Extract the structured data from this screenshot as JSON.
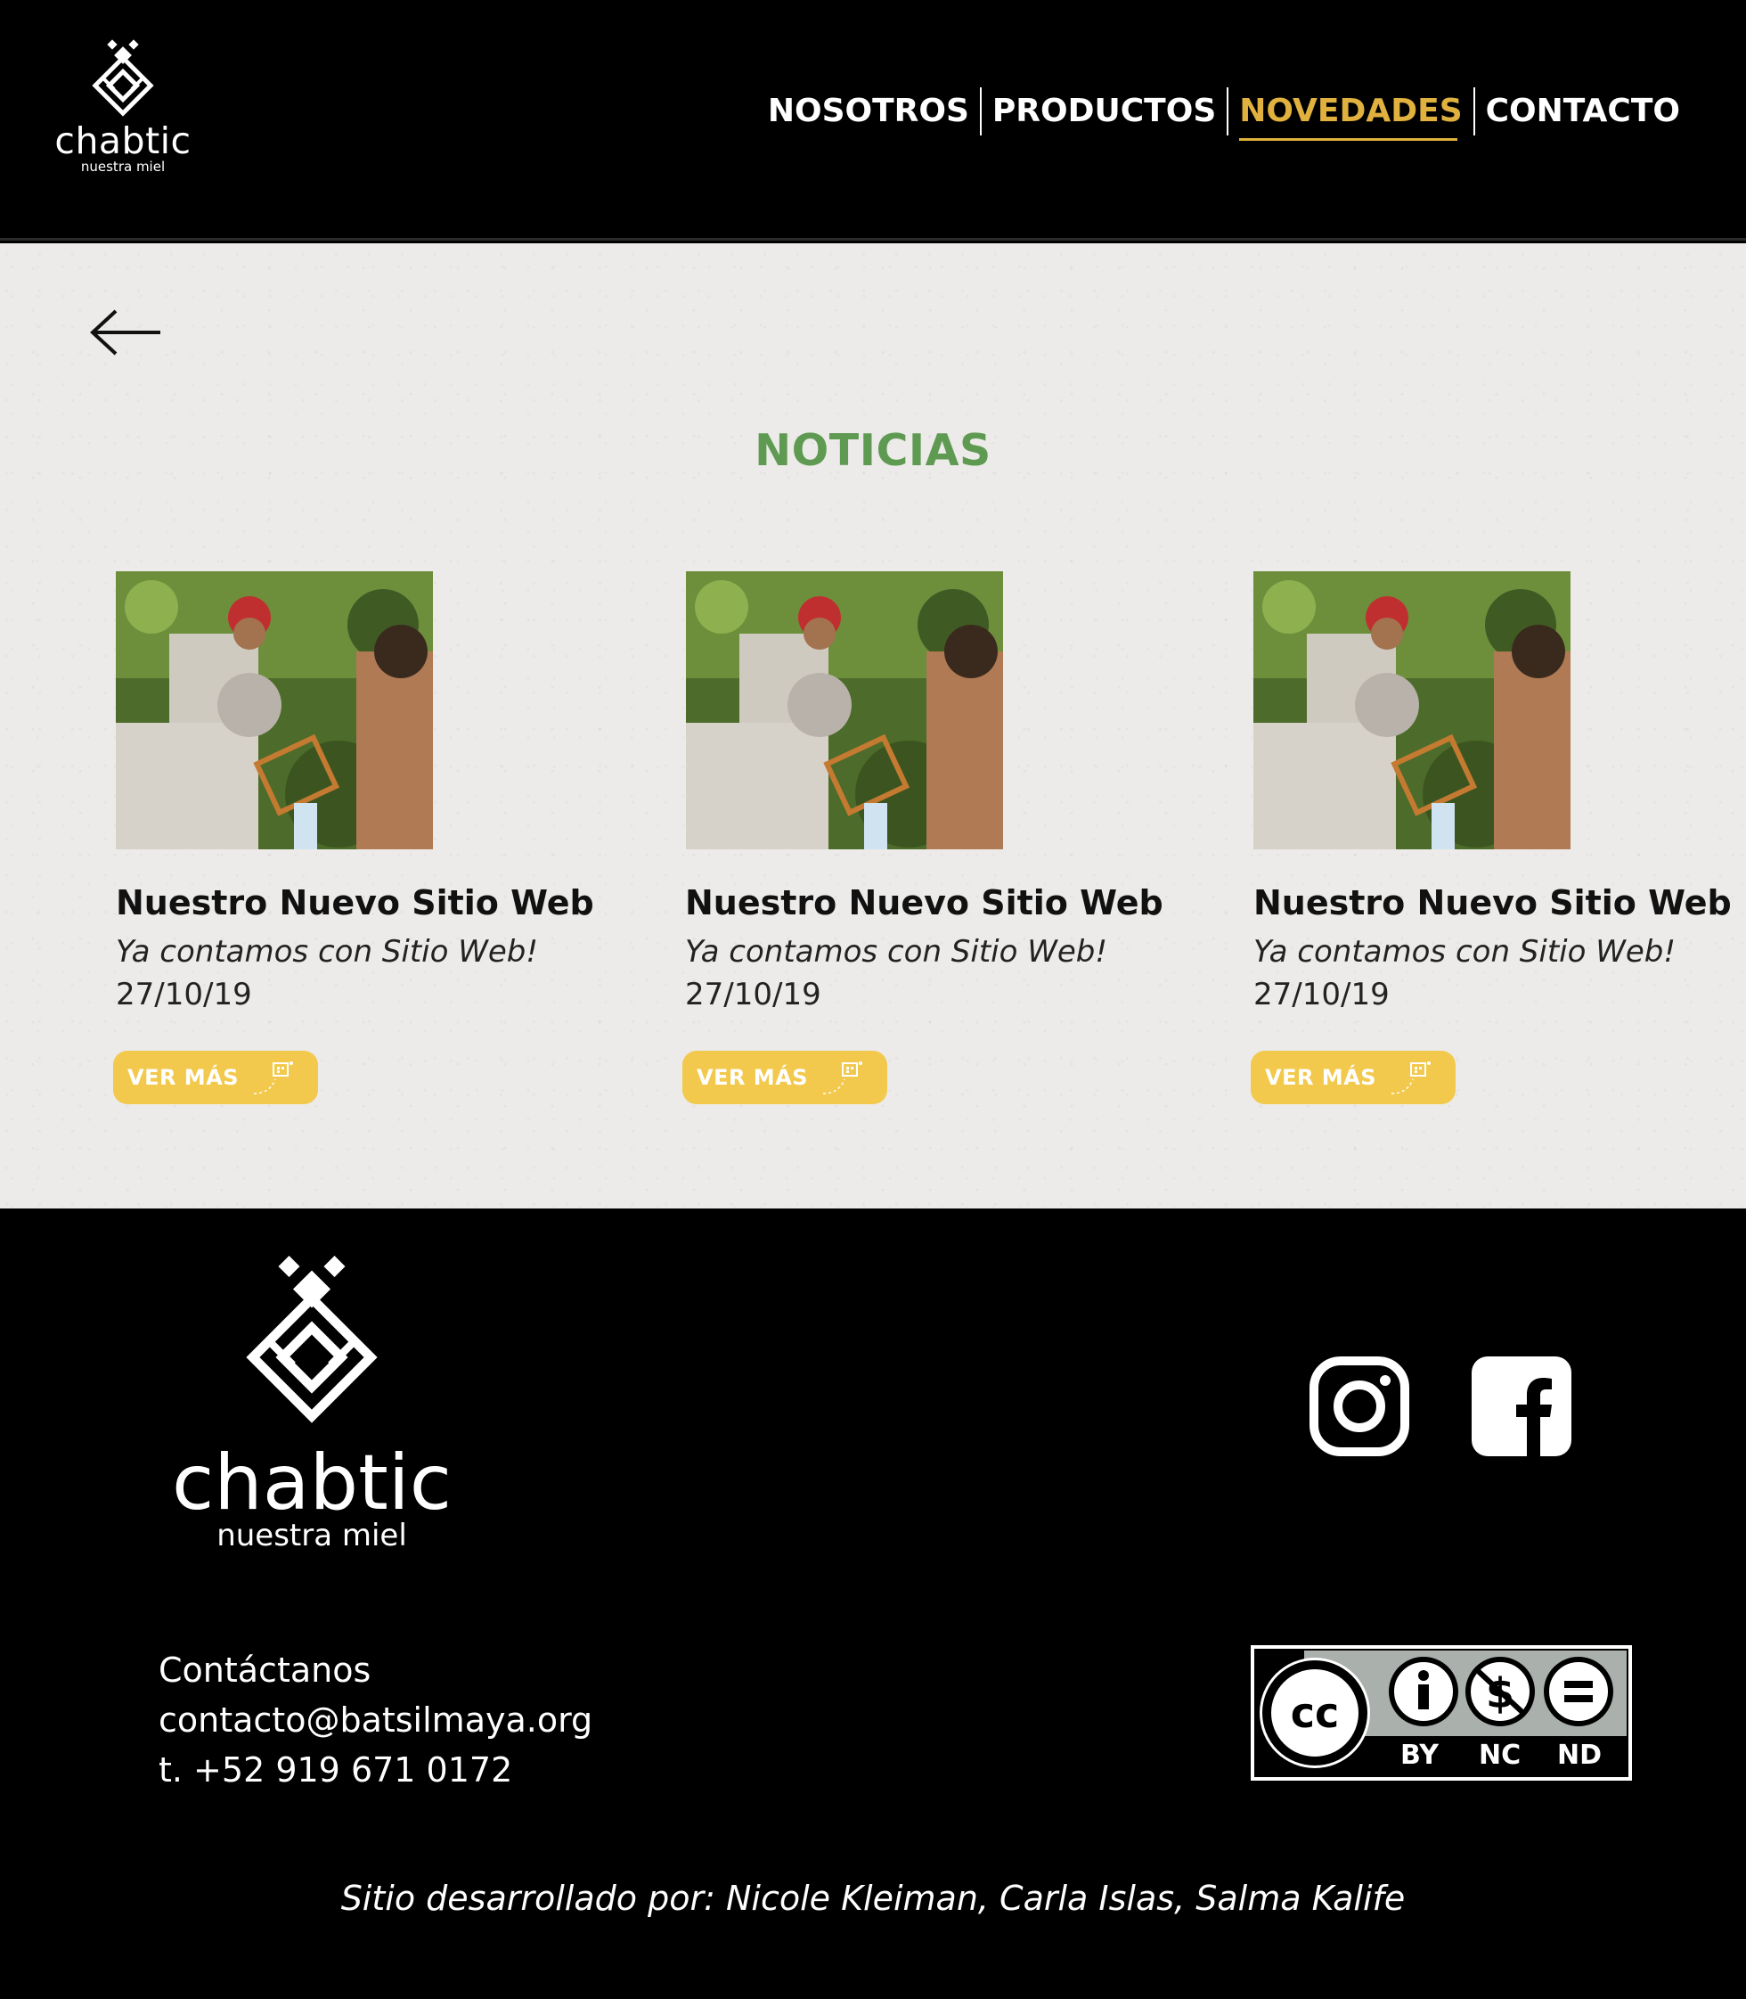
{
  "header": {
    "logo": {
      "brand": "chabtic",
      "tagline": "nuestra miel"
    },
    "nav": [
      {
        "label": "NOSOTROS",
        "active": false
      },
      {
        "label": "PRODUCTOS",
        "active": false
      },
      {
        "label": "NOVEDADES",
        "active": true
      },
      {
        "label": "CONTACTO",
        "active": false
      }
    ]
  },
  "main": {
    "back_icon": "arrow-left-icon",
    "section_title": "NOTICIAS",
    "cards": [
      {
        "title": "Nuestro Nuevo Sitio Web",
        "subtitle": "Ya contamos con Sitio Web!",
        "date": "27/10/19",
        "button": "VER MÁS"
      },
      {
        "title": "Nuestro Nuevo Sitio Web",
        "subtitle": "Ya contamos con Sitio Web!",
        "date": "27/10/19",
        "button": "VER MÁS"
      },
      {
        "title": "Nuestro Nuevo Sitio Web",
        "subtitle": "Ya contamos con Sitio Web!",
        "date": "27/10/19",
        "button": "VER MÁS"
      }
    ]
  },
  "footer": {
    "logo": {
      "brand": "chabtic",
      "tagline": "nuestra miel"
    },
    "social": [
      "instagram-icon",
      "facebook-icon"
    ],
    "contact": {
      "heading": "Contáctanos",
      "email": "contacto@batsilmaya.org",
      "phone": "t. +52 919 671 0172"
    },
    "license": {
      "labels": [
        "BY",
        "NC",
        "ND"
      ]
    },
    "credits": "Sitio desarrollado por: Nicole Kleiman, Carla Islas, Salma Kalife"
  },
  "colors": {
    "accent": "#e0b13e",
    "title_green": "#5f9a52",
    "button_yellow": "#f2c94c",
    "background": "#ecebe9"
  }
}
